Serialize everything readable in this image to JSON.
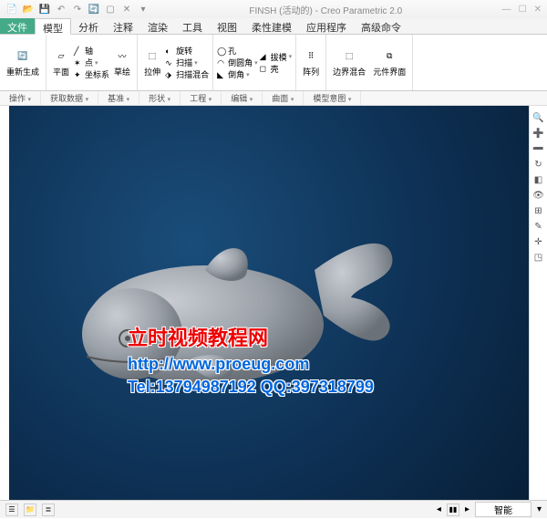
{
  "title": "FINSH (活动的) - Creo Parametric 2.0",
  "tabs": {
    "file": "文件",
    "model": "模型",
    "analysis": "分析",
    "annotate": "注释",
    "render": "渲染",
    "tools": "工具",
    "view": "视图",
    "flex": "柔性建模",
    "app": "应用程序",
    "adv": "高级命令"
  },
  "ribbon": {
    "regen": {
      "label": "重新生成",
      "group": "操作"
    },
    "datum": {
      "plane": "平面",
      "axis": "轴",
      "point": "点",
      "csys": "坐标系",
      "sketch": "草绘",
      "group": "获取数据",
      "group2": "基准"
    },
    "shape": {
      "extrude": "拉伸",
      "revolve": "旋转",
      "sweep": "扫描",
      "blend": "扫描混合",
      "hole": "孔",
      "draft": "拔模",
      "shell": "壳",
      "round": "倒圆角",
      "chamfer": "倒角",
      "group": "形状",
      "group2": "工程"
    },
    "pattern": {
      "label": "阵列",
      "group": "编辑"
    },
    "surface": {
      "bnd": "边界混合",
      "interface": "元件界面",
      "group": "曲面",
      "group2": "模型意图"
    }
  },
  "subbar": [
    "操作",
    "获取数据",
    "基准",
    "形状",
    "工程",
    "编辑",
    "曲面",
    "模型意图"
  ],
  "watermark": {
    "line1": "立时视频教程网",
    "line2": "http://www.proeug.com",
    "line3": "Tel:13794987192   QQ:397318799"
  },
  "status": {
    "mode": "智能"
  }
}
